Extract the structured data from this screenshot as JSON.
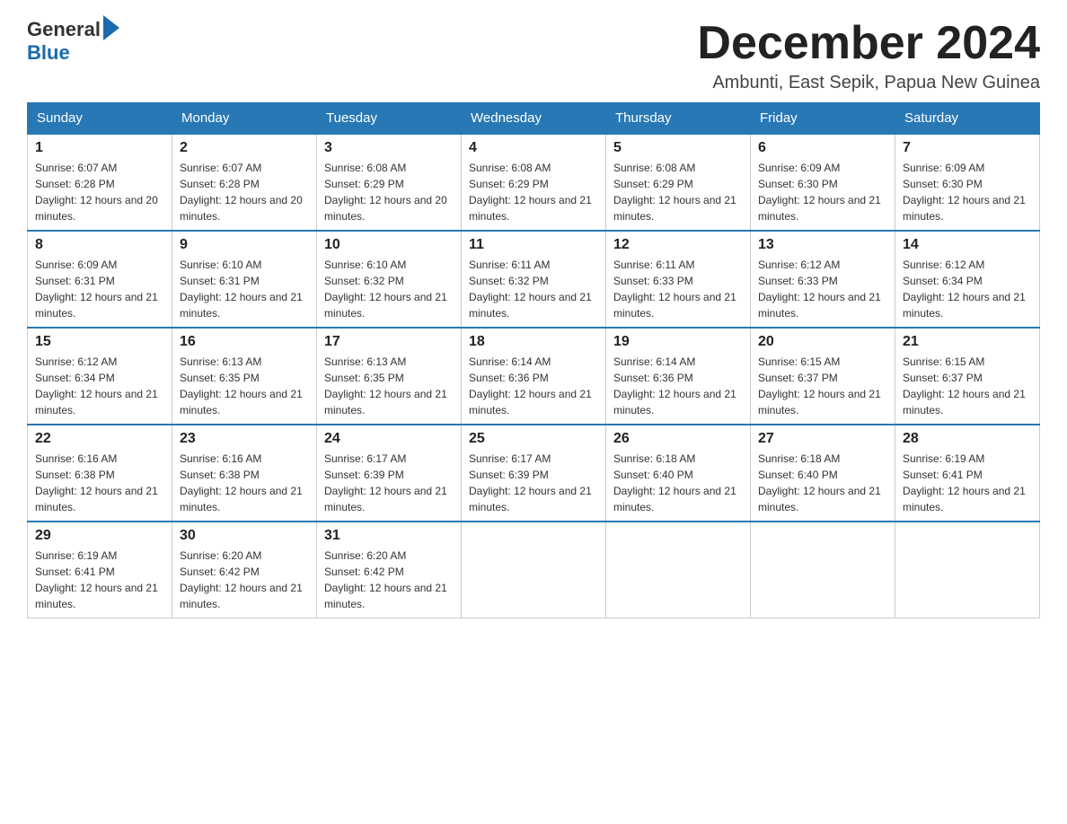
{
  "header": {
    "logo_general": "General",
    "logo_blue": "Blue",
    "month": "December 2024",
    "location": "Ambunti, East Sepik, Papua New Guinea"
  },
  "weekdays": [
    "Sunday",
    "Monday",
    "Tuesday",
    "Wednesday",
    "Thursday",
    "Friday",
    "Saturday"
  ],
  "weeks": [
    [
      {
        "day": "1",
        "sunrise": "6:07 AM",
        "sunset": "6:28 PM",
        "daylight": "12 hours and 20 minutes."
      },
      {
        "day": "2",
        "sunrise": "6:07 AM",
        "sunset": "6:28 PM",
        "daylight": "12 hours and 20 minutes."
      },
      {
        "day": "3",
        "sunrise": "6:08 AM",
        "sunset": "6:29 PM",
        "daylight": "12 hours and 20 minutes."
      },
      {
        "day": "4",
        "sunrise": "6:08 AM",
        "sunset": "6:29 PM",
        "daylight": "12 hours and 21 minutes."
      },
      {
        "day": "5",
        "sunrise": "6:08 AM",
        "sunset": "6:29 PM",
        "daylight": "12 hours and 21 minutes."
      },
      {
        "day": "6",
        "sunrise": "6:09 AM",
        "sunset": "6:30 PM",
        "daylight": "12 hours and 21 minutes."
      },
      {
        "day": "7",
        "sunrise": "6:09 AM",
        "sunset": "6:30 PM",
        "daylight": "12 hours and 21 minutes."
      }
    ],
    [
      {
        "day": "8",
        "sunrise": "6:09 AM",
        "sunset": "6:31 PM",
        "daylight": "12 hours and 21 minutes."
      },
      {
        "day": "9",
        "sunrise": "6:10 AM",
        "sunset": "6:31 PM",
        "daylight": "12 hours and 21 minutes."
      },
      {
        "day": "10",
        "sunrise": "6:10 AM",
        "sunset": "6:32 PM",
        "daylight": "12 hours and 21 minutes."
      },
      {
        "day": "11",
        "sunrise": "6:11 AM",
        "sunset": "6:32 PM",
        "daylight": "12 hours and 21 minutes."
      },
      {
        "day": "12",
        "sunrise": "6:11 AM",
        "sunset": "6:33 PM",
        "daylight": "12 hours and 21 minutes."
      },
      {
        "day": "13",
        "sunrise": "6:12 AM",
        "sunset": "6:33 PM",
        "daylight": "12 hours and 21 minutes."
      },
      {
        "day": "14",
        "sunrise": "6:12 AM",
        "sunset": "6:34 PM",
        "daylight": "12 hours and 21 minutes."
      }
    ],
    [
      {
        "day": "15",
        "sunrise": "6:12 AM",
        "sunset": "6:34 PM",
        "daylight": "12 hours and 21 minutes."
      },
      {
        "day": "16",
        "sunrise": "6:13 AM",
        "sunset": "6:35 PM",
        "daylight": "12 hours and 21 minutes."
      },
      {
        "day": "17",
        "sunrise": "6:13 AM",
        "sunset": "6:35 PM",
        "daylight": "12 hours and 21 minutes."
      },
      {
        "day": "18",
        "sunrise": "6:14 AM",
        "sunset": "6:36 PM",
        "daylight": "12 hours and 21 minutes."
      },
      {
        "day": "19",
        "sunrise": "6:14 AM",
        "sunset": "6:36 PM",
        "daylight": "12 hours and 21 minutes."
      },
      {
        "day": "20",
        "sunrise": "6:15 AM",
        "sunset": "6:37 PM",
        "daylight": "12 hours and 21 minutes."
      },
      {
        "day": "21",
        "sunrise": "6:15 AM",
        "sunset": "6:37 PM",
        "daylight": "12 hours and 21 minutes."
      }
    ],
    [
      {
        "day": "22",
        "sunrise": "6:16 AM",
        "sunset": "6:38 PM",
        "daylight": "12 hours and 21 minutes."
      },
      {
        "day": "23",
        "sunrise": "6:16 AM",
        "sunset": "6:38 PM",
        "daylight": "12 hours and 21 minutes."
      },
      {
        "day": "24",
        "sunrise": "6:17 AM",
        "sunset": "6:39 PM",
        "daylight": "12 hours and 21 minutes."
      },
      {
        "day": "25",
        "sunrise": "6:17 AM",
        "sunset": "6:39 PM",
        "daylight": "12 hours and 21 minutes."
      },
      {
        "day": "26",
        "sunrise": "6:18 AM",
        "sunset": "6:40 PM",
        "daylight": "12 hours and 21 minutes."
      },
      {
        "day": "27",
        "sunrise": "6:18 AM",
        "sunset": "6:40 PM",
        "daylight": "12 hours and 21 minutes."
      },
      {
        "day": "28",
        "sunrise": "6:19 AM",
        "sunset": "6:41 PM",
        "daylight": "12 hours and 21 minutes."
      }
    ],
    [
      {
        "day": "29",
        "sunrise": "6:19 AM",
        "sunset": "6:41 PM",
        "daylight": "12 hours and 21 minutes."
      },
      {
        "day": "30",
        "sunrise": "6:20 AM",
        "sunset": "6:42 PM",
        "daylight": "12 hours and 21 minutes."
      },
      {
        "day": "31",
        "sunrise": "6:20 AM",
        "sunset": "6:42 PM",
        "daylight": "12 hours and 21 minutes."
      },
      null,
      null,
      null,
      null
    ]
  ]
}
